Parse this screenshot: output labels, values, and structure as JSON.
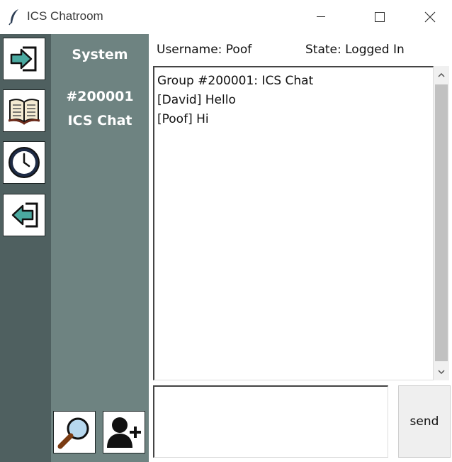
{
  "window": {
    "title": "ICS Chatroom",
    "app_icon": "feather-icon"
  },
  "nav": [
    {
      "name": "login-button",
      "icon": "login-arrow-icon"
    },
    {
      "name": "book-button",
      "icon": "book-icon"
    },
    {
      "name": "history-button",
      "icon": "clock-icon"
    },
    {
      "name": "logout-button",
      "icon": "logout-arrow-icon"
    }
  ],
  "panel": {
    "heading": "System",
    "group_number": "#200001",
    "group_name": "ICS Chat",
    "search_icon": "magnifier-icon",
    "add_user_icon": "add-user-icon"
  },
  "status": {
    "username": "Username: Poof",
    "state": "State: Logged In"
  },
  "chat": {
    "lines": [
      "Group #200001: ICS Chat",
      "[David] Hello",
      "[Poof] Hi"
    ]
  },
  "input": {
    "value": ""
  },
  "send_label": "send",
  "colors": {
    "nav_bar": "#4f6060",
    "side_panel": "#6e8381",
    "icon_accent": "#4aa9a0"
  }
}
